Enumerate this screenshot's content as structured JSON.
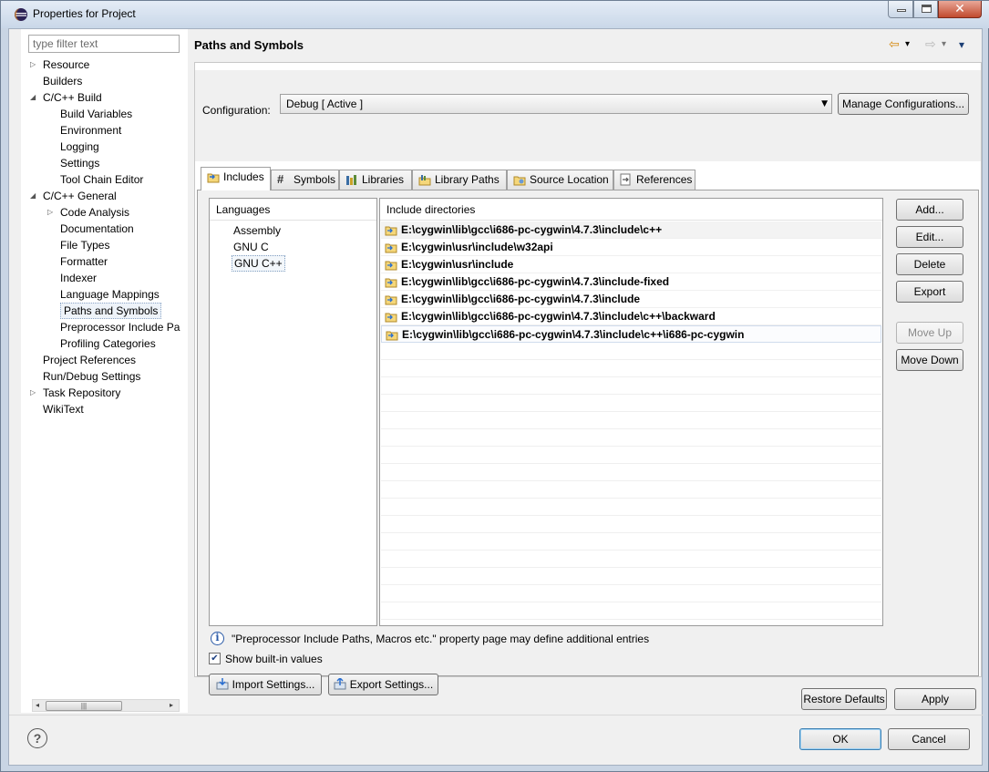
{
  "window": {
    "title": "Properties for Project",
    "close_glyph": "✕"
  },
  "filter": {
    "placeholder": "type filter text"
  },
  "nav_tree": [
    {
      "label": "Resource",
      "arrow": "▷",
      "indent": 0
    },
    {
      "label": "Builders",
      "arrow": "",
      "indent": 0
    },
    {
      "label": "C/C++ Build",
      "arrow": "◢",
      "indent": 0
    },
    {
      "label": "Build Variables",
      "arrow": "",
      "indent": 1
    },
    {
      "label": "Environment",
      "arrow": "",
      "indent": 1
    },
    {
      "label": "Logging",
      "arrow": "",
      "indent": 1
    },
    {
      "label": "Settings",
      "arrow": "",
      "indent": 1
    },
    {
      "label": "Tool Chain Editor",
      "arrow": "",
      "indent": 1
    },
    {
      "label": "C/C++ General",
      "arrow": "◢",
      "indent": 0
    },
    {
      "label": "Code Analysis",
      "arrow": "▷",
      "indent": 1
    },
    {
      "label": "Documentation",
      "arrow": "",
      "indent": 1
    },
    {
      "label": "File Types",
      "arrow": "",
      "indent": 1
    },
    {
      "label": "Formatter",
      "arrow": "",
      "indent": 1
    },
    {
      "label": "Indexer",
      "arrow": "",
      "indent": 1
    },
    {
      "label": "Language Mappings",
      "arrow": "",
      "indent": 1
    },
    {
      "label": "Paths and Symbols",
      "arrow": "",
      "indent": 1,
      "selected": true
    },
    {
      "label": "Preprocessor Include Pa",
      "arrow": "",
      "indent": 1
    },
    {
      "label": "Profiling Categories",
      "arrow": "",
      "indent": 1
    },
    {
      "label": "Project References",
      "arrow": "",
      "indent": 0
    },
    {
      "label": "Run/Debug Settings",
      "arrow": "",
      "indent": 0
    },
    {
      "label": "Task Repository",
      "arrow": "▷",
      "indent": 0
    },
    {
      "label": "WikiText",
      "arrow": "",
      "indent": 0
    }
  ],
  "page": {
    "title": "Paths and Symbols",
    "configuration_label": "Configuration:",
    "configuration_value": "Debug  [ Active ]",
    "manage_label": "Manage Configurations...",
    "nav_back": "⇦",
    "nav_fwd": "⇨",
    "nav_drop": "▾"
  },
  "tabs": [
    {
      "label": "Includes",
      "active": true,
      "icon": "includes-icon"
    },
    {
      "label": "Symbols",
      "active": false,
      "icon": "hash-icon"
    },
    {
      "label": "Libraries",
      "active": false,
      "icon": "libraries-icon"
    },
    {
      "label": "Library Paths",
      "active": false,
      "icon": "library-paths-icon"
    },
    {
      "label": "Source Location",
      "active": false,
      "icon": "folder-icon"
    },
    {
      "label": "References",
      "active": false,
      "icon": "references-icon"
    }
  ],
  "languages": {
    "header": "Languages",
    "items": [
      "Assembly",
      "GNU C",
      "GNU C++"
    ],
    "selected": "GNU C++"
  },
  "include_dirs": {
    "header": "Include directories",
    "items": [
      "E:\\cygwin\\lib\\gcc\\i686-pc-cygwin\\4.7.3\\include\\c++",
      "E:\\cygwin\\usr\\include\\w32api",
      "E:\\cygwin\\usr\\include",
      "E:\\cygwin\\lib\\gcc\\i686-pc-cygwin\\4.7.3\\include-fixed",
      "E:\\cygwin\\lib\\gcc\\i686-pc-cygwin\\4.7.3\\include",
      "E:\\cygwin\\lib\\gcc\\i686-pc-cygwin\\4.7.3\\include\\c++\\backward",
      "E:\\cygwin\\lib\\gcc\\i686-pc-cygwin\\4.7.3\\include\\c++\\i686-pc-cygwin"
    ]
  },
  "side_buttons": {
    "add": "Add...",
    "edit": "Edit...",
    "delete": "Delete",
    "export": "Export",
    "move_up": "Move Up",
    "move_down": "Move Down"
  },
  "info_icon_glyph": "i",
  "info_text": "\"Preprocessor Include Paths, Macros etc.\" property page may define additional entries",
  "show_builtin": {
    "label": "Show built-in values",
    "checked": true,
    "glyph": "✔"
  },
  "import_label": "Import Settings...",
  "export_label": "Export Settings...",
  "scroll_grip": "|||",
  "scroll_left": "◂",
  "scroll_right": "▸",
  "restore_label": "Restore Defaults",
  "apply_label": "Apply",
  "help_glyph": "?",
  "ok_label": "OK",
  "cancel_label": "Cancel"
}
